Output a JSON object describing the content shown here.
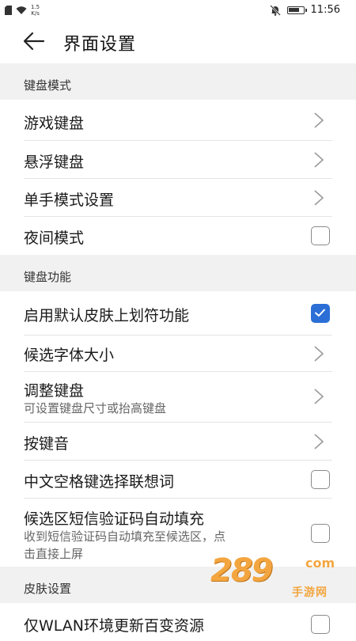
{
  "status_bar": {
    "net_speed_value": "1.5",
    "net_speed_unit": "K/s",
    "time": "11:56",
    "battery_level": 0.85
  },
  "header": {
    "title": "界面设置"
  },
  "sections": [
    {
      "title": "键盘模式",
      "items": [
        {
          "title": "游戏键盘",
          "control": "chevron"
        },
        {
          "title": "悬浮键盘",
          "control": "chevron"
        },
        {
          "title": "单手模式设置",
          "control": "chevron"
        },
        {
          "title": "夜间模式",
          "control": "checkbox",
          "checked": false
        }
      ]
    },
    {
      "title": "键盘功能",
      "items": [
        {
          "title": "启用默认皮肤上划符功能",
          "control": "checkbox",
          "checked": true
        },
        {
          "title": "候选字体大小",
          "control": "chevron"
        },
        {
          "title": "调整键盘",
          "subtitle": "可设置键盘尺寸或抬高键盘",
          "control": "chevron"
        },
        {
          "title": "按键音",
          "control": "chevron"
        },
        {
          "title": "中文空格键选择联想词",
          "control": "checkbox",
          "checked": false
        },
        {
          "title": "候选区短信验证码自动填充",
          "subtitle_lines": [
            "收到短信验证码自动填充至候选区，点",
            "击直接上屏"
          ],
          "control": "checkbox",
          "checked": false
        }
      ]
    },
    {
      "title": "皮肤设置",
      "items": [
        {
          "title": "仅WLAN环境更新百变资源",
          "control": "checkbox",
          "checked": false
        }
      ]
    }
  ],
  "watermark": {
    "main": "289",
    "suffix": "com",
    "sub": "手游网"
  },
  "colors": {
    "accent": "#2b6fd6",
    "section_bg": "#f1f1f1",
    "divider": "#e4e4e4"
  }
}
